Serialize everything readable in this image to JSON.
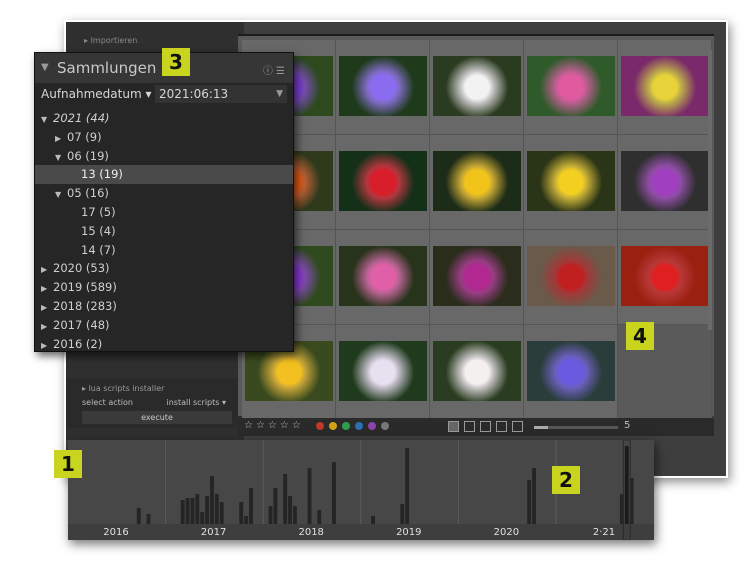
{
  "import_label": "Importieren",
  "collections": {
    "title": "Sammlungen",
    "filter_label": "Aufnahmedatum",
    "filter_value": "2021:06:13",
    "tree": [
      {
        "label": "2021 (44)",
        "indent": 0,
        "expanded": true,
        "selected": false,
        "italic": true
      },
      {
        "label": "07 (9)",
        "indent": 1,
        "expanded": false,
        "selected": false
      },
      {
        "label": "06 (19)",
        "indent": 1,
        "expanded": true,
        "selected": false
      },
      {
        "label": "13 (19)",
        "indent": 2,
        "leaf": true,
        "selected": true
      },
      {
        "label": "05 (16)",
        "indent": 1,
        "expanded": true,
        "selected": false
      },
      {
        "label": "17 (5)",
        "indent": 2,
        "leaf": true,
        "selected": false
      },
      {
        "label": "15 (4)",
        "indent": 2,
        "leaf": true,
        "selected": false
      },
      {
        "label": "14 (7)",
        "indent": 2,
        "leaf": true,
        "selected": false
      },
      {
        "label": "2020 (53)",
        "indent": 0,
        "expanded": false,
        "selected": false
      },
      {
        "label": "2019 (589)",
        "indent": 0,
        "expanded": false,
        "selected": false
      },
      {
        "label": "2018 (283)",
        "indent": 0,
        "expanded": false,
        "selected": false
      },
      {
        "label": "2017 (48)",
        "indent": 0,
        "expanded": false,
        "selected": false
      },
      {
        "label": "2016 (2)",
        "indent": 0,
        "expanded": false,
        "selected": false
      }
    ]
  },
  "lua": {
    "title": "lua scripts installer",
    "select_action": "select action",
    "install_scripts": "install scripts ▾",
    "execute": "execute"
  },
  "bottombar": {
    "stars": "☆☆☆☆☆",
    "color_labels": [
      "#c0392b",
      "#d4a017",
      "#2e9e4a",
      "#2e6fb0",
      "#8e44ad",
      "#777777"
    ],
    "zoom_value": "5",
    "zoom_level": 0.17
  },
  "thumbnails": [
    {
      "bg": "#2d4a1f",
      "flower": "#7b3fcf"
    },
    {
      "bg": "#1e3a1a",
      "flower": "#8a6cf0"
    },
    {
      "bg": "#2b3b20",
      "flower": "#f2f2f2"
    },
    {
      "bg": "#2f5a2a",
      "flower": "#e05aa0"
    },
    {
      "bg": "#7a2a6a",
      "flower": "#e8d23a"
    },
    {
      "bg": "#2f3a1d",
      "flower": "#e05a1a"
    },
    {
      "bg": "#143018",
      "flower": "#d81e2a"
    },
    {
      "bg": "#1d2c18",
      "flower": "#f2c41a"
    },
    {
      "bg": "#2a3416",
      "flower": "#f2cf20"
    },
    {
      "bg": "#2f2f2f",
      "flower": "#a040c0"
    },
    {
      "bg": "#304a20",
      "flower": "#8a3ad0"
    },
    {
      "bg": "#27331a",
      "flower": "#e060a8"
    },
    {
      "bg": "#2a2d1c",
      "flower": "#b02890"
    },
    {
      "bg": "#6a5a4a",
      "flower": "#c02020"
    },
    {
      "bg": "#9a2010",
      "flower": "#e02020"
    },
    {
      "bg": "#3a4a1f",
      "flower": "#f2c020"
    },
    {
      "bg": "#1f3a1c",
      "flower": "#e6e0f0"
    },
    {
      "bg": "#2a3d20",
      "flower": "#f4f0f0"
    },
    {
      "bg": "#2a3d3a",
      "flower": "#6a5ae0"
    }
  ],
  "timeline": {
    "years": [
      "2016",
      "2017",
      "2018",
      "2019",
      "2020",
      "2021"
    ],
    "year_labels": [
      "2016",
      "2017",
      "2018",
      "2019",
      "2020",
      "2·21"
    ],
    "bars": [
      [
        0,
        0,
        0,
        0,
        0,
        0,
        0,
        0,
        0,
        0,
        0,
        0,
        0,
        0,
        16,
        0,
        10,
        0,
        0,
        0
      ],
      [
        0,
        0,
        0,
        24,
        26,
        26,
        30,
        12,
        28,
        48,
        30,
        22,
        0,
        0,
        0,
        22,
        8,
        36,
        0,
        0
      ],
      [
        0,
        18,
        36,
        0,
        50,
        28,
        18,
        0,
        0,
        56,
        0,
        14,
        0,
        0,
        62,
        0,
        0,
        0,
        0,
        0
      ],
      [
        0,
        0,
        8,
        0,
        0,
        0,
        0,
        0,
        20,
        76,
        0,
        0,
        0,
        0,
        0,
        0,
        0,
        0,
        0,
        0
      ],
      [
        0,
        0,
        0,
        0,
        0,
        0,
        0,
        0,
        0,
        0,
        0,
        0,
        0,
        0,
        44,
        56,
        0,
        0,
        0,
        0
      ],
      [
        0,
        0,
        0,
        0,
        0,
        0,
        0,
        0,
        0,
        0,
        0,
        0,
        0,
        30,
        78,
        46,
        0,
        0,
        0,
        0
      ]
    ]
  },
  "callouts": [
    "1",
    "2",
    "3",
    "4"
  ]
}
